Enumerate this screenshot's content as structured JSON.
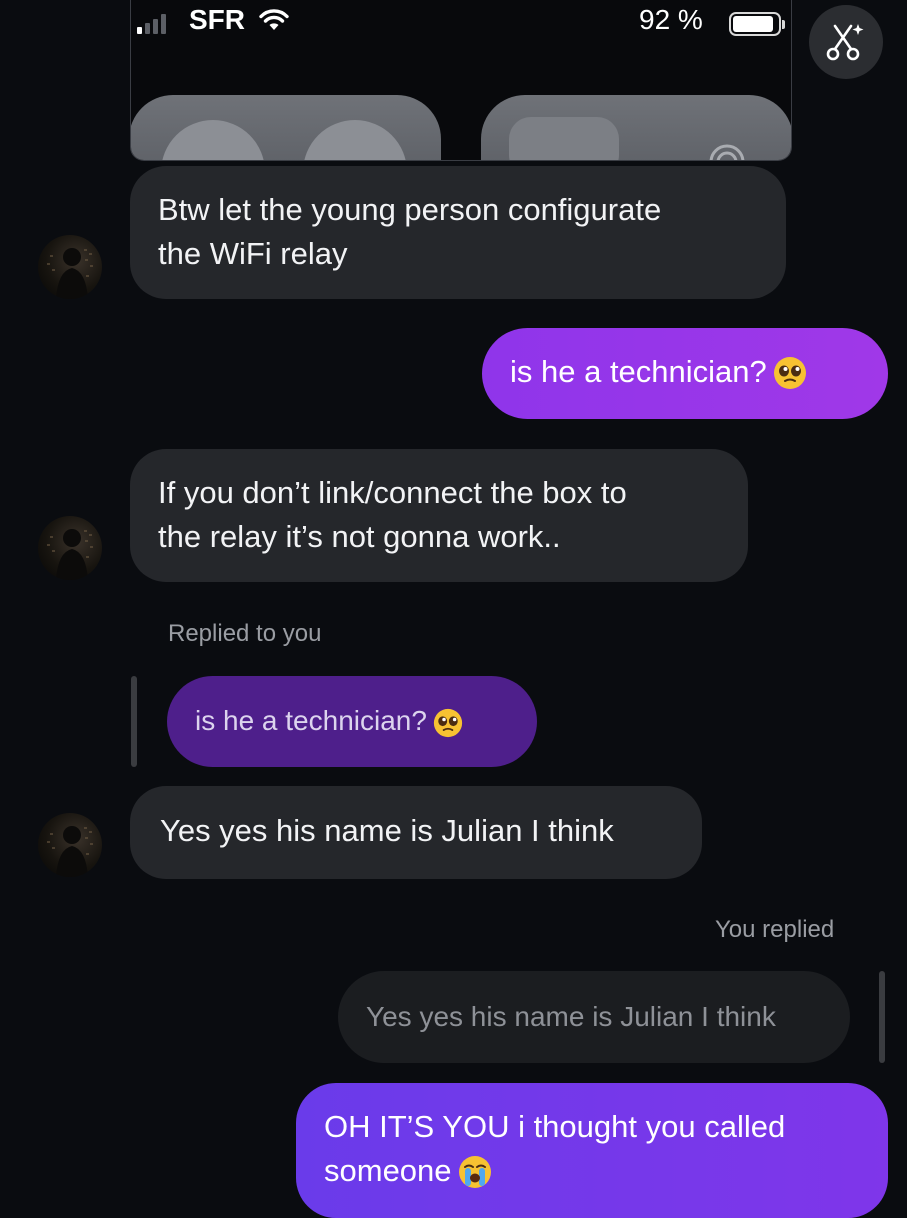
{
  "status_bar": {
    "carrier": "SFR",
    "battery_percent": "92 %",
    "battery_level": 0.92,
    "signal_bars_active": 1,
    "signal_bars_total": 4
  },
  "top_button": {
    "icon": "magic-scissors-icon"
  },
  "messages": [
    {
      "direction": "incoming",
      "line1": "Btw let the young person configurate",
      "line2": "the WiFi relay"
    },
    {
      "direction": "outgoing",
      "text": "is he a technician?",
      "emoji": "pleading-face"
    },
    {
      "direction": "incoming",
      "line1": "If you don’t link/connect the box to",
      "line2": "the relay it’s not gonna work.."
    },
    {
      "direction": "incoming",
      "reply_label": "Replied to you",
      "reply_preview": "is he a technician?",
      "reply_emoji": "pleading-face",
      "text": "Yes yes his name is Julian I think"
    },
    {
      "direction": "outgoing",
      "reply_label": "You replied",
      "reply_preview": "Yes yes his name is Julian I think",
      "line1": "OH IT’S YOU i thought you called",
      "line2": "someone",
      "emoji": "loudly-crying-face"
    }
  ],
  "colors": {
    "background": "#0a0c10",
    "incoming_bubble": "#25272b",
    "outgoing_bubble": "#9437e9",
    "outgoing_bubble_alt": "#6f3aea",
    "reply_preview_purple": "#4e1f8b",
    "secondary_text": "#9a9da3"
  }
}
